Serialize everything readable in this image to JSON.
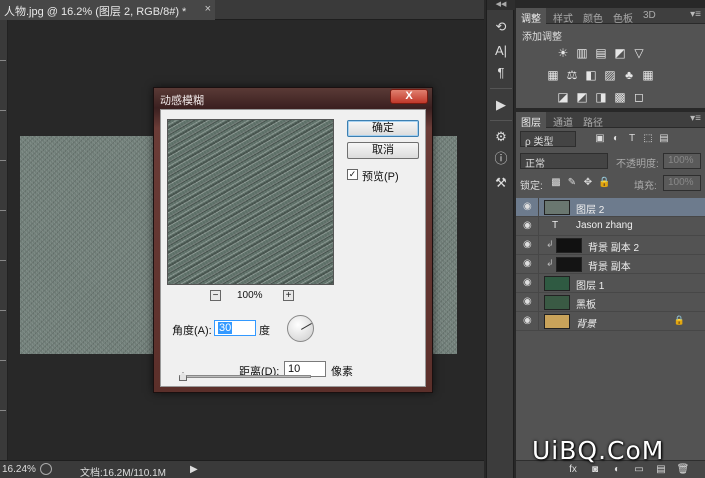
{
  "document": {
    "tab_title": "人物.jpg @ 16.2% (图层 2, RGB/8#) *",
    "close_symbol": "×"
  },
  "status": {
    "zoom": "16.24%",
    "doc_info": "文档:16.2M/110.1M",
    "arrow": "▶"
  },
  "tools": {
    "collapse": "◀◀",
    "items": [
      {
        "name": "history-icon",
        "glyph": "⟲"
      },
      {
        "name": "character-icon",
        "glyph": "A|"
      },
      {
        "name": "paragraph-icon",
        "glyph": "¶"
      },
      {
        "name": "play-actions-icon",
        "glyph": "▶"
      },
      {
        "name": "brush-presets-icon",
        "glyph": "⚙"
      },
      {
        "name": "info-icon",
        "glyph": "ⓘ"
      },
      {
        "name": "tool-presets-icon",
        "glyph": "⚒"
      }
    ]
  },
  "adjustments_panel": {
    "tabs": [
      "调整",
      "样式",
      "颜色",
      "色板",
      "3D"
    ],
    "menu": "▾≡",
    "title": "添加调整",
    "icons_row1": [
      "☀",
      "▥",
      "▤",
      "◩",
      "▽"
    ],
    "icons_row2": [
      "▦",
      "⚖",
      "◧",
      "▨",
      "♣",
      "▦"
    ],
    "icons_row3": [
      "◪",
      "◩",
      "◨",
      "▩",
      "◻"
    ]
  },
  "layers_panel": {
    "tabs": [
      "图层",
      "通道",
      "路径"
    ],
    "menu": "▾≡",
    "filter_kind": "ρ 类型",
    "filter_icons": [
      "▣",
      "◐",
      "T",
      "⬚",
      "▤"
    ],
    "blend_mode": "正常",
    "opacity_label": "不透明度:",
    "opacity_value": "100%",
    "lock_label": "锁定:",
    "lock_icons": [
      "▩",
      "✎",
      "✥",
      "🔒"
    ],
    "fill_label": "填充:",
    "fill_value": "100%",
    "layers": [
      {
        "name": "图层 2",
        "selected": true,
        "thumb": "#6a7770",
        "kind": "raster",
        "link": "",
        "italic": false,
        "locked": false
      },
      {
        "name": "Jason zhang",
        "selected": false,
        "thumb": "",
        "kind": "text",
        "link": "",
        "italic": false,
        "locked": false
      },
      {
        "name": "背景 副本 2",
        "selected": false,
        "thumb": "#111",
        "kind": "raster",
        "link": "↲",
        "italic": false,
        "locked": false
      },
      {
        "name": "背景 副本",
        "selected": false,
        "thumb": "#141414",
        "kind": "raster",
        "link": "↲",
        "italic": false,
        "locked": false
      },
      {
        "name": "图层 1",
        "selected": false,
        "thumb": "#2f5a42",
        "kind": "raster",
        "link": "",
        "italic": false,
        "locked": false
      },
      {
        "name": "黑板",
        "selected": false,
        "thumb": "#3a5a44",
        "kind": "raster",
        "link": "",
        "italic": false,
        "locked": false
      },
      {
        "name": "背景",
        "selected": false,
        "thumb": "#c9a35a",
        "kind": "raster",
        "link": "",
        "italic": true,
        "locked": true
      }
    ],
    "eye_glyph": "◉",
    "text_glyph": "T",
    "lock_glyph": "🔒",
    "bottom_icons": [
      "fx",
      "◙",
      "◐",
      "▭",
      "▤",
      "🗑"
    ]
  },
  "dialog": {
    "title": "动感模糊",
    "close": "X",
    "ok_label": "确定",
    "cancel_label": "取消",
    "preview_label": "预览(P)",
    "preview_checked": "✓",
    "zoom_minus": "−",
    "zoom_plus": "+",
    "zoom_value": "100%",
    "angle_label": "角度(A):",
    "angle_value": "30",
    "angle_unit": "度",
    "distance_label": "距离(D):",
    "distance_value": "10",
    "distance_unit": "像素",
    "distance_level": 0.03
  },
  "watermark": "UiBQ.CoM"
}
